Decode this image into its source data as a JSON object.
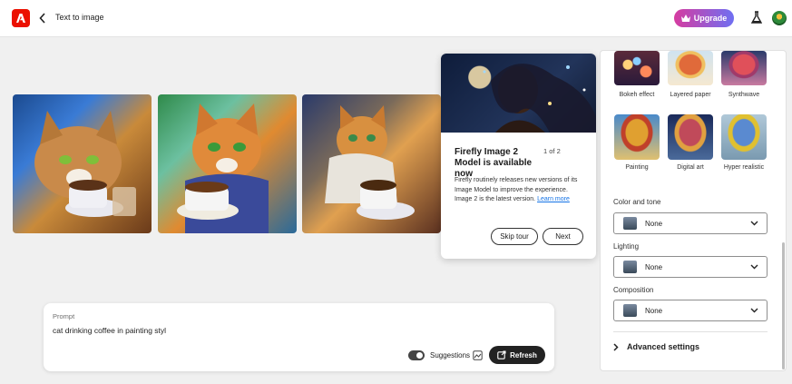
{
  "header": {
    "title": "Text to image",
    "upgrade_label": "Upgrade"
  },
  "gallery": {
    "images": [
      {
        "alt": "cat drinking coffee painting 1"
      },
      {
        "alt": "cat drinking coffee painting 2"
      },
      {
        "alt": "cat drinking coffee painting 3"
      }
    ]
  },
  "tour": {
    "title": "Firefly Image 2 Model is available now",
    "counter": "1 of 2",
    "body": "Firefly routinely releases new versions of its Image Model to improve the experience. Image 2 is the latest version.",
    "link": "Learn more",
    "skip_label": "Skip tour",
    "next_label": "Next"
  },
  "panel": {
    "styles": [
      {
        "label": "Bokeh effect"
      },
      {
        "label": "Layered paper"
      },
      {
        "label": "Synthwave"
      },
      {
        "label": "Painting"
      },
      {
        "label": "Digital art"
      },
      {
        "label": "Hyper realistic"
      }
    ],
    "color_tone": {
      "label": "Color and tone",
      "value": "None"
    },
    "lighting": {
      "label": "Lighting",
      "value": "None"
    },
    "composition": {
      "label": "Composition",
      "value": "None"
    },
    "advanced_label": "Advanced settings"
  },
  "prompt": {
    "label": "Prompt",
    "value": "cat drinking coffee in painting styl",
    "suggestions_label": "Suggestions",
    "refresh_label": "Refresh"
  },
  "colors": {
    "adobe_red": "#eb1000",
    "link_blue": "#1473e6",
    "dark_button": "#222222"
  }
}
